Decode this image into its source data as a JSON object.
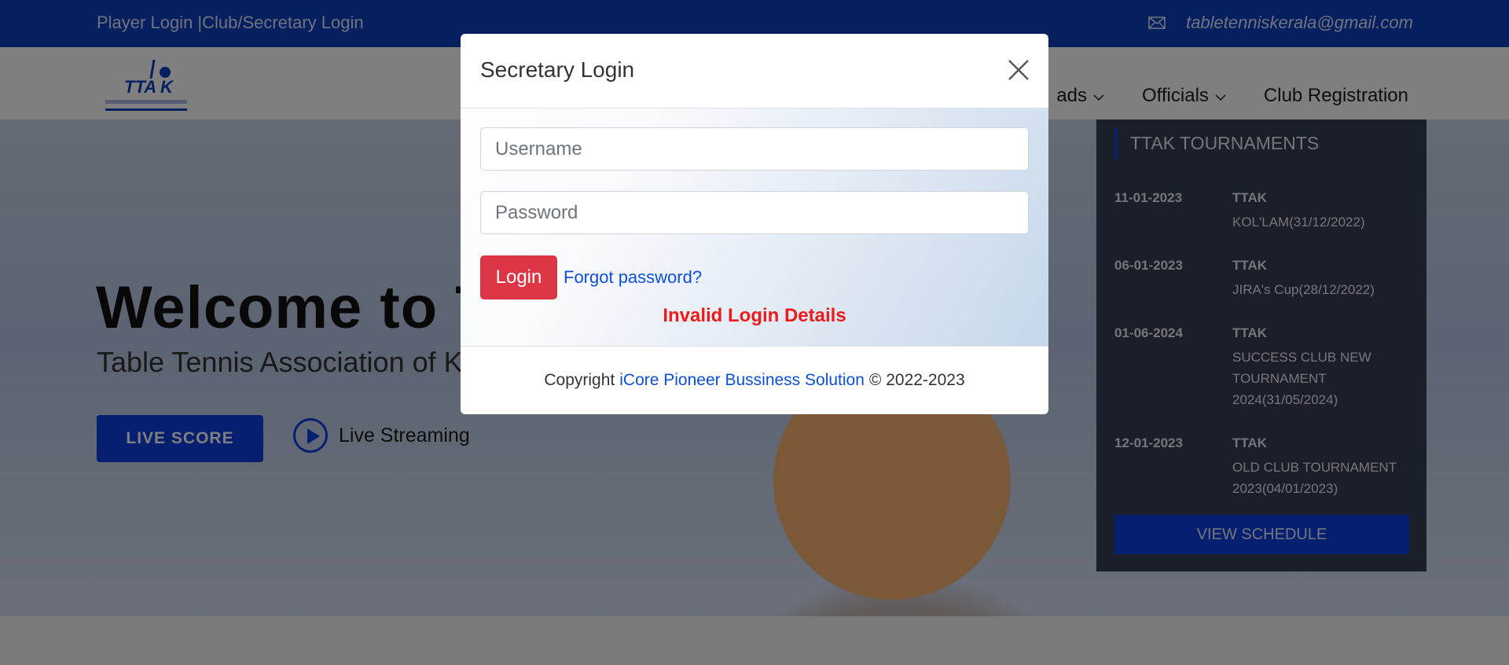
{
  "topbar": {
    "player_login": "Player Login",
    "separator": " |",
    "club_login": "Club/Secretary Login",
    "email": "tabletenniskerala@gmail.com"
  },
  "nav": {
    "items": [
      {
        "label": "ads",
        "has_dropdown": true
      },
      {
        "label": "Officials",
        "has_dropdown": true
      },
      {
        "label": "Club Registration",
        "has_dropdown": false
      }
    ]
  },
  "hero": {
    "title": "Welcome to T",
    "subtitle": "Table Tennis Association of K",
    "live_score": "LIVE SCORE",
    "live_streaming": "Live Streaming"
  },
  "sidebar": {
    "title": "TTAK TOURNAMENTS",
    "events": [
      {
        "date": "11-01-2023",
        "org": "TTAK",
        "name": "KOL'LAM(31/12/2022)"
      },
      {
        "date": "06-01-2023",
        "org": "TTAK",
        "name": "JIRA's Cup(28/12/2022)"
      },
      {
        "date": "01-06-2024",
        "org": "TTAK",
        "name": "SUCCESS CLUB NEW TOURNAMENT 2024(31/05/2024)"
      },
      {
        "date": "12-01-2023",
        "org": "TTAK",
        "name": "OLD CLUB TOURNAMENT 2023(04/01/2023)"
      }
    ],
    "view_schedule": "VIEW SCHEDULE"
  },
  "modal": {
    "title": "Secretary Login",
    "username_placeholder": "Username",
    "password_placeholder": "Password",
    "login_label": "Login",
    "forgot_label": "Forgot password?",
    "error": "Invalid Login Details",
    "footer_prefix": "Copyright",
    "footer_link": "iCore Pioneer Bussiness Solution",
    "footer_suffix": "© 2022-2023"
  },
  "colors": {
    "brand_blue": "#0d3fbf",
    "login_red": "#dc3545",
    "error_red": "#ee1b1b"
  }
}
